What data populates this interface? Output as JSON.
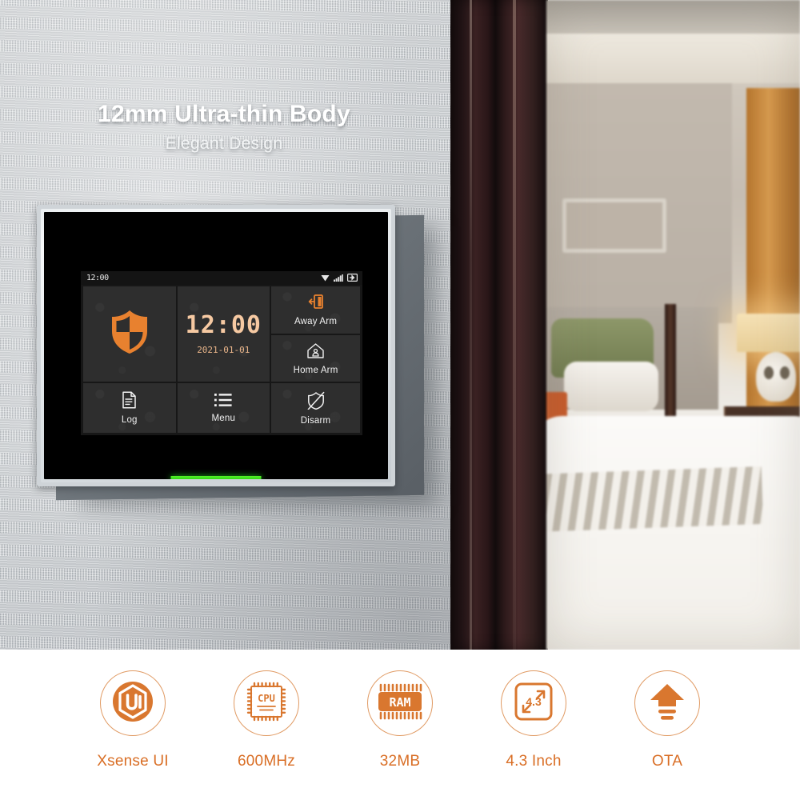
{
  "hero": {
    "headline": "12mm Ultra-thin Body",
    "subheadline": "Elegant Design",
    "scene": {
      "wall_description": "textured grey fabric wall",
      "doorway_description": "dark wooden door jamb",
      "room_description": "blurred bedroom with bed, pillows, table lamp and nightstand"
    }
  },
  "device": {
    "status_bar": {
      "time": "12:00",
      "icons": [
        "wifi-icon",
        "cellular-signal-icon",
        "sim-card-icon"
      ]
    },
    "tiles": [
      {
        "id": "shield",
        "icon": "shield-icon",
        "label": ""
      },
      {
        "id": "clock",
        "icon": "clock-display",
        "label": ""
      },
      {
        "id": "away",
        "icon": "exit-door-icon",
        "label": "Away Arm"
      },
      {
        "id": "home",
        "icon": "house-person-icon",
        "label": "Home Arm"
      },
      {
        "id": "log",
        "icon": "document-icon",
        "label": "Log"
      },
      {
        "id": "menu",
        "icon": "list-icon",
        "label": "Menu"
      },
      {
        "id": "disarm",
        "icon": "shield-slash-icon",
        "label": "Disarm"
      }
    ],
    "clock": {
      "time": "12:00",
      "date": "2021-01-01"
    },
    "led": {
      "name": "status-led",
      "color": "#2ee016"
    }
  },
  "features": [
    {
      "id": "xsense-ui",
      "icon": "ui-hexagon-icon",
      "label": "Xsense UI",
      "badge": "UI"
    },
    {
      "id": "cpu",
      "icon": "cpu-chip-icon",
      "label": "600MHz",
      "badge": "CPU"
    },
    {
      "id": "ram",
      "icon": "ram-chip-icon",
      "label": "32MB",
      "badge": "RAM"
    },
    {
      "id": "screen",
      "icon": "screen-size-icon",
      "label": "4.3 Inch",
      "badge": "4.3"
    },
    {
      "id": "ota",
      "icon": "ota-upload-icon",
      "label": "OTA",
      "badge": ""
    }
  ],
  "colors": {
    "accent_orange": "#d96e25",
    "icon_orange": "#e8812f",
    "clock_peach": "#f6c9a2",
    "led_green": "#2ee016",
    "tile_bg": "#2e2e2e",
    "screen_bg": "#171717"
  }
}
